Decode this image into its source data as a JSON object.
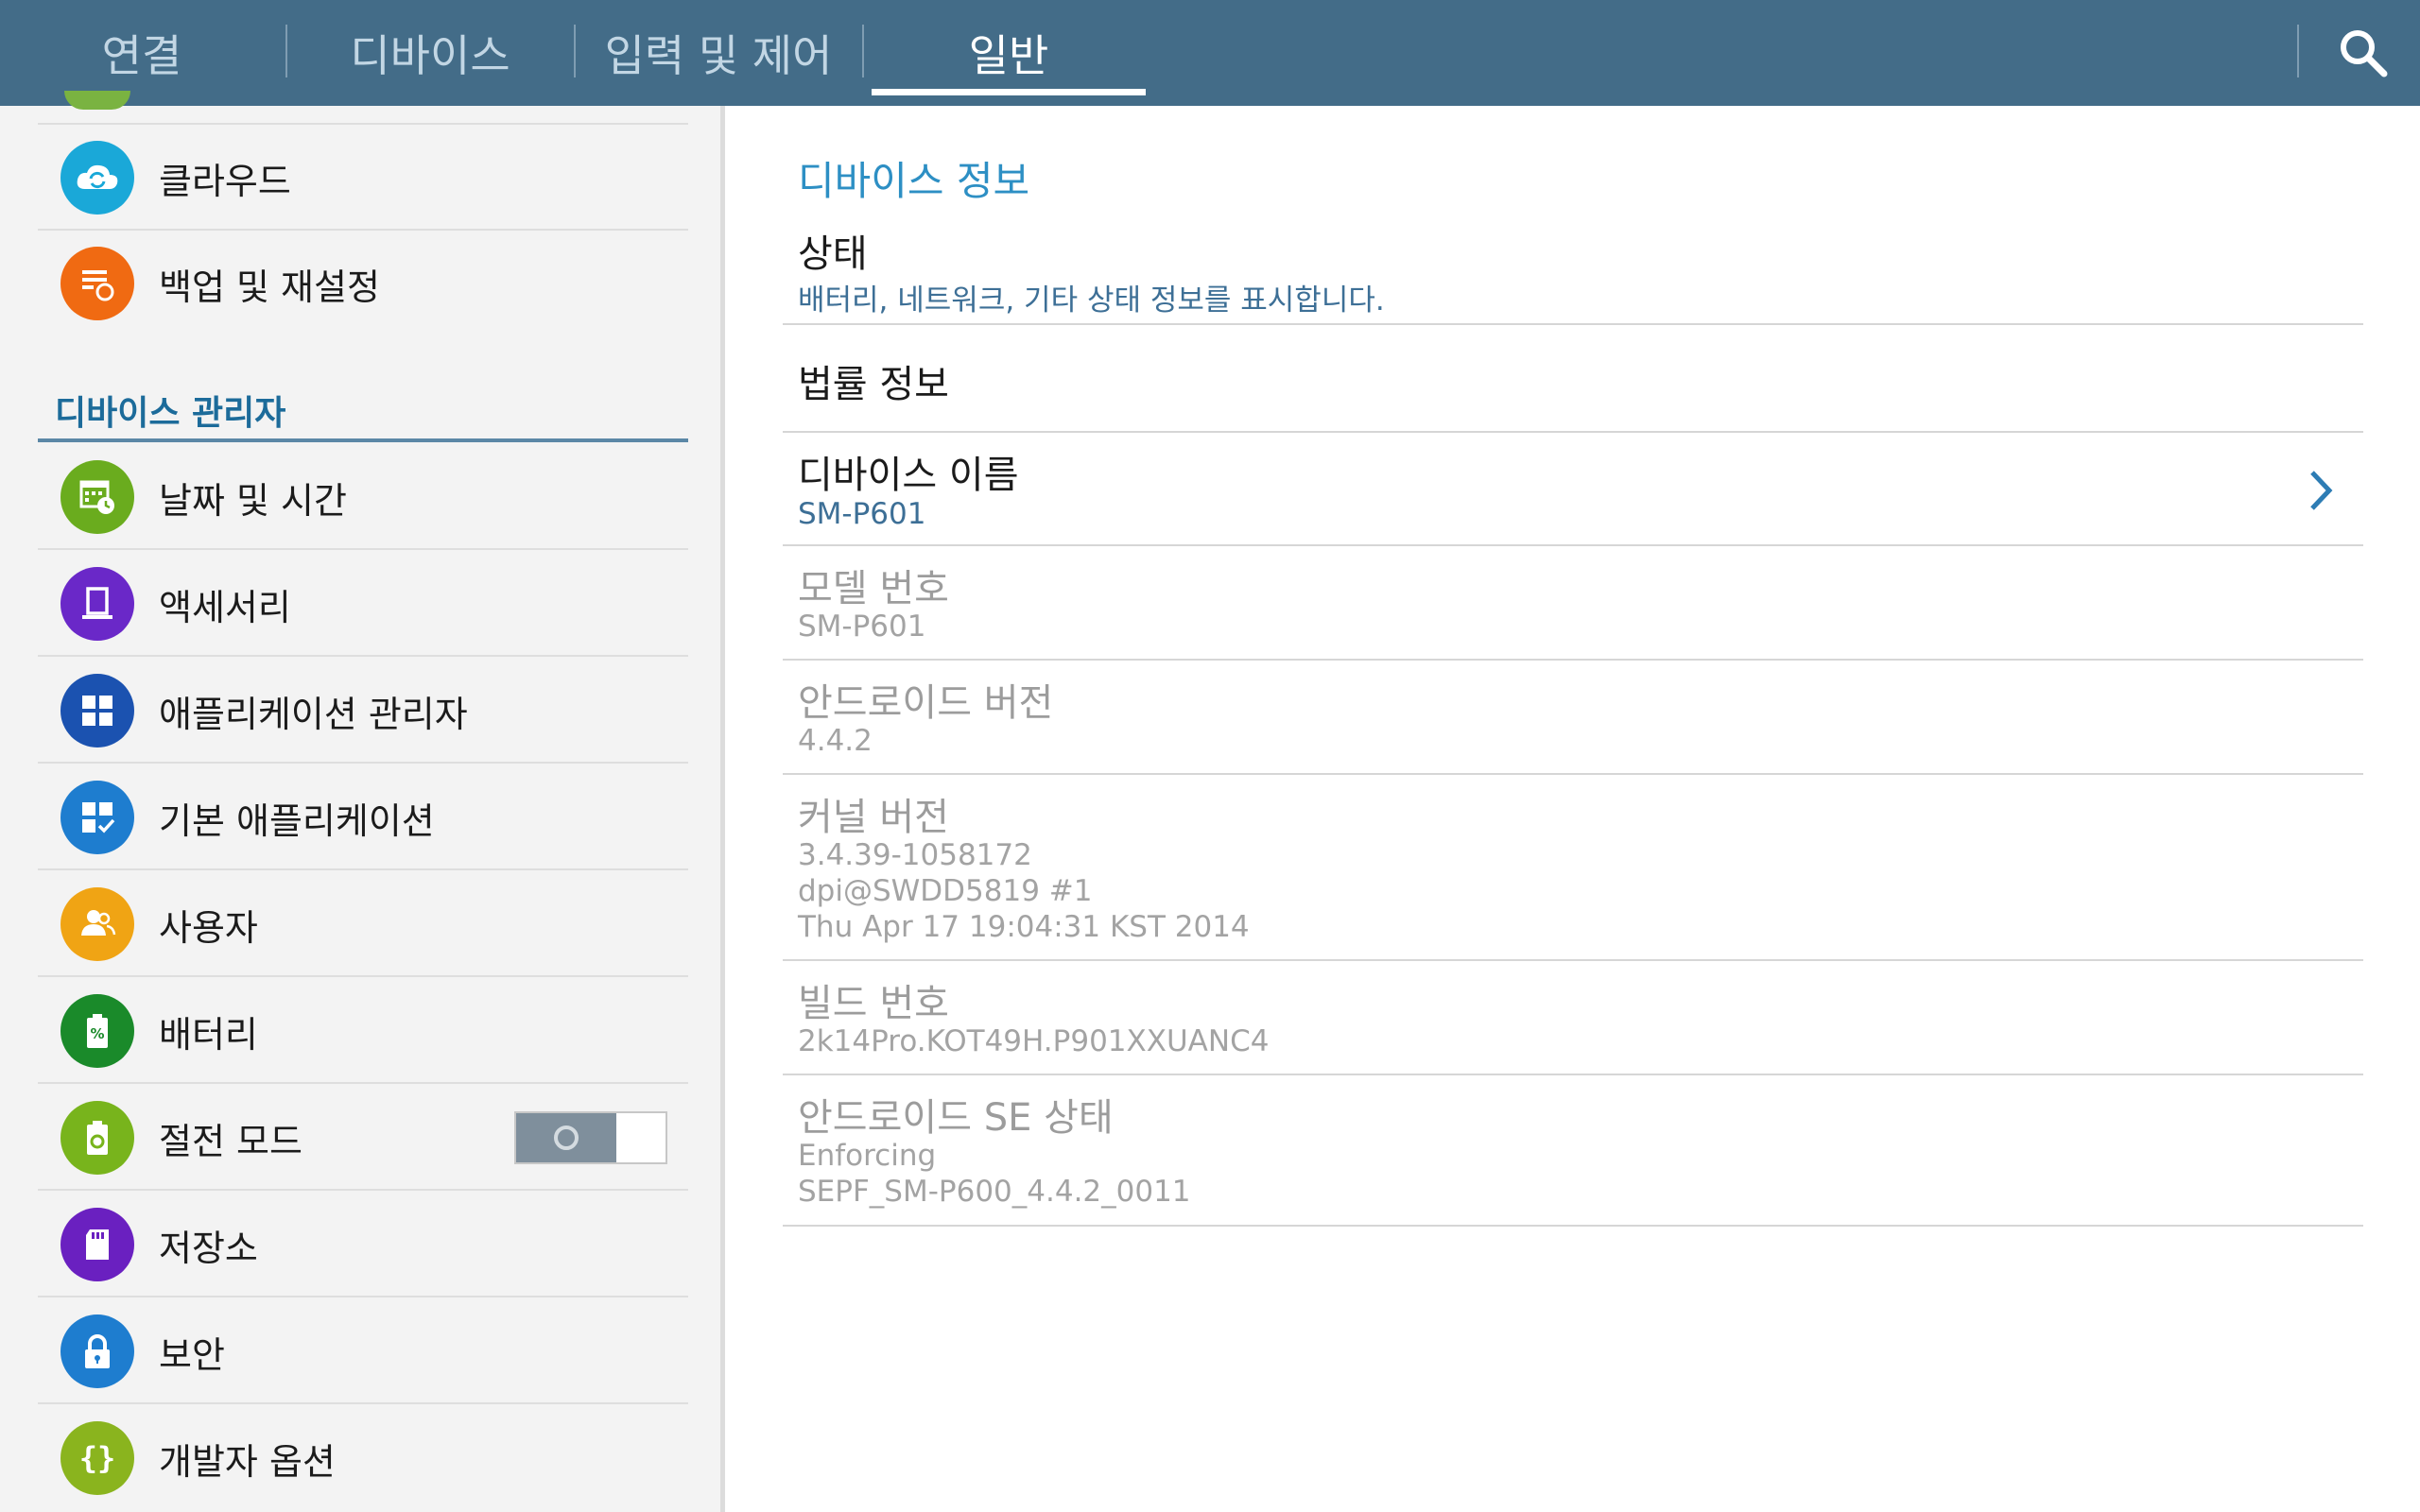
{
  "tabs": [
    {
      "label": "연결",
      "active": false
    },
    {
      "label": "디바이스",
      "active": false
    },
    {
      "label": "입력 및 제어",
      "active": false
    },
    {
      "label": "일반",
      "active": true
    }
  ],
  "search_icon": "search-icon",
  "left_list": {
    "items_top": [
      {
        "label": "클라우드",
        "icon": "cloud-sync-icon",
        "color": "#1aa8d8"
      },
      {
        "label": "백업 및 재설정",
        "icon": "backup-reset-icon",
        "color": "#f06a12"
      }
    ],
    "section_title": "디바이스 관리자",
    "items": [
      {
        "label": "날짜 및 시간",
        "icon": "calendar-clock-icon",
        "color": "#6aac1e"
      },
      {
        "label": "액세서리",
        "icon": "accessory-icon",
        "color": "#6a28c8"
      },
      {
        "label": "애플리케이션 관리자",
        "icon": "app-grid-icon",
        "color": "#1b52b0"
      },
      {
        "label": "기본 애플리케이션",
        "icon": "default-apps-icon",
        "color": "#1e7dcf"
      },
      {
        "label": "사용자",
        "icon": "users-icon",
        "color": "#f0a414"
      },
      {
        "label": "배터리",
        "icon": "battery-icon",
        "color": "#1a8a2a"
      },
      {
        "label": "절전 모드",
        "icon": "power-saving-icon",
        "color": "#78b41c"
      },
      {
        "label": "저장소",
        "icon": "sd-card-icon",
        "color": "#6a20c0"
      },
      {
        "label": "보안",
        "icon": "lock-icon",
        "color": "#1e7dcf"
      },
      {
        "label": "개발자 옵션",
        "icon": "braces-icon",
        "color": "#8ab41e"
      }
    ]
  },
  "power_saving_toggle": {
    "state": "off"
  },
  "device_info": {
    "title": "디바이스 정보",
    "status": {
      "label": "상태",
      "sub": "배터리, 네트워크, 기타 상태 정보를 표시합니다."
    },
    "legal": {
      "label": "법률 정보"
    },
    "device_name": {
      "label": "디바이스 이름",
      "value": "SM-P601"
    },
    "model": {
      "label": "모델 번호",
      "value": "SM-P601"
    },
    "android_version": {
      "label": "안드로이드 버전",
      "value": "4.4.2"
    },
    "kernel": {
      "label": "커널 버전",
      "line1": "3.4.39-1058172",
      "line2": "dpi@SWDD5819 #1",
      "line3": "Thu Apr 17 19:04:31 KST 2014"
    },
    "build": {
      "label": "빌드 번호",
      "value": "2k14Pro.KOT49H.P901XXUANC4"
    },
    "se_status": {
      "label": "안드로이드 SE 상태",
      "line1": "Enforcing",
      "line2": "SEPF_SM-P600_4.4.2_0011"
    }
  }
}
